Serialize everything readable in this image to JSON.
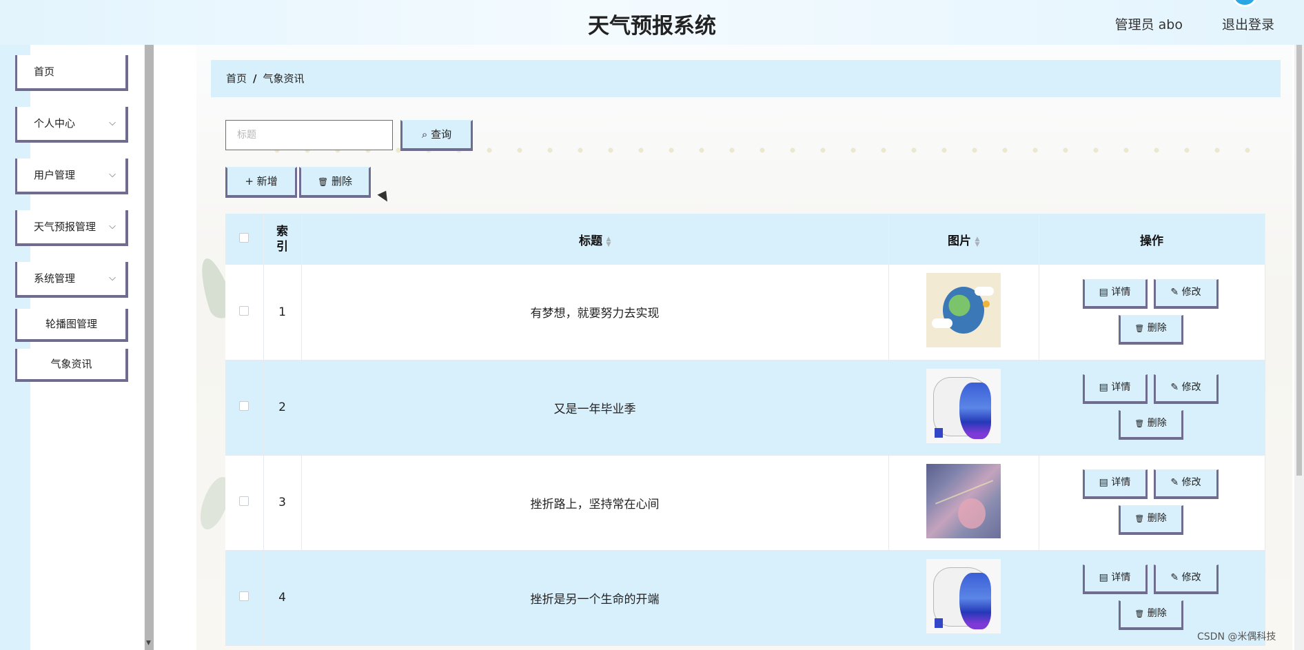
{
  "header": {
    "title": "天气预报系统",
    "user": "管理员 abo",
    "logout": "退出登录"
  },
  "sidebar": {
    "items": [
      {
        "label": "首页"
      },
      {
        "label": "个人中心"
      },
      {
        "label": "用户管理"
      },
      {
        "label": "天气预报管理"
      },
      {
        "label": "系统管理"
      }
    ],
    "sub_items": [
      {
        "label": "轮播图管理"
      },
      {
        "label": "气象资讯"
      }
    ],
    "chevron": "⌵"
  },
  "breadcrumb": {
    "home": "首页",
    "separator": "/",
    "current": "气象资讯"
  },
  "search": {
    "placeholder": "标题",
    "value": "",
    "query_label": "查询"
  },
  "toolbar": {
    "add_label": "新增",
    "delete_label": "删除"
  },
  "table": {
    "columns": {
      "index": "索\n引",
      "title": "标题",
      "image": "图片",
      "action": "操作"
    },
    "sort_caret": "▲▼",
    "rows": [
      {
        "index": "1",
        "title": "有梦想，就要努力去实现",
        "image": "earth-illustration"
      },
      {
        "index": "2",
        "title": "又是一年毕业季",
        "image": "rain-map"
      },
      {
        "index": "3",
        "title": "挫折路上，坚持常在心间",
        "image": "satellite-cloud"
      },
      {
        "index": "4",
        "title": "挫折是另一个生命的开端",
        "image": "rain-map"
      }
    ],
    "actions": {
      "detail": "详情",
      "edit": "修改",
      "delete": "删除"
    }
  },
  "icons": {
    "search": "⌕",
    "plus": "+",
    "trash": "🗑",
    "doc": "▤",
    "pen": "✎"
  },
  "colors": {
    "accent": "#d8effc",
    "border": "#706c8f"
  },
  "watermark": "CSDN @米偶科技"
}
